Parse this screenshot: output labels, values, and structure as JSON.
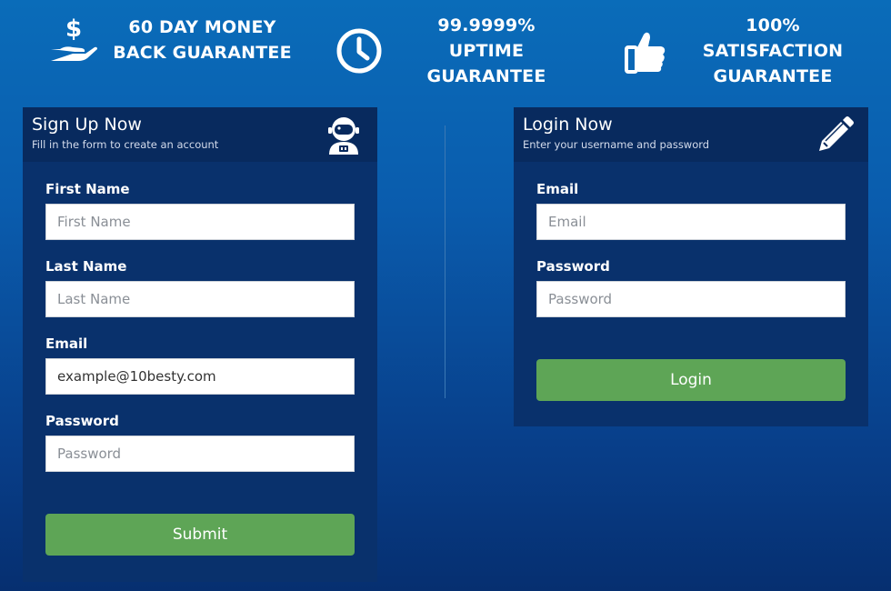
{
  "guarantees": [
    {
      "icon": "money-hand-icon",
      "text": "60 DAY MONEY BACK GUARANTEE"
    },
    {
      "icon": "clock-icon",
      "text": "99.9999% UPTIME GUARANTEE"
    },
    {
      "icon": "thumbs-up-icon",
      "text": "100% SATISFACTION GUARANTEE"
    }
  ],
  "signup": {
    "title": "Sign Up Now",
    "subtitle": "Fill in the form to create an account",
    "icon": "astronaut-icon",
    "fields": [
      {
        "label": "First Name",
        "placeholder": "First Name",
        "value": ""
      },
      {
        "label": "Last Name",
        "placeholder": "Last Name",
        "value": ""
      },
      {
        "label": "Email",
        "placeholder": "Email",
        "value": "example@10besty.com"
      },
      {
        "label": "Password",
        "placeholder": "Password",
        "value": ""
      }
    ],
    "submit_label": "Submit"
  },
  "login": {
    "title": "Login Now",
    "subtitle": "Enter your username and password",
    "icon": "pencil-icon",
    "fields": [
      {
        "label": "Email",
        "placeholder": "Email",
        "value": ""
      },
      {
        "label": "Password",
        "placeholder": "Password",
        "value": ""
      }
    ],
    "submit_label": "Login"
  },
  "colors": {
    "background_top": "#0a6cb9",
    "background_bottom": "#062f70",
    "panel": "#09316c",
    "panel_header": "#082a5e",
    "button": "#5ea556"
  }
}
